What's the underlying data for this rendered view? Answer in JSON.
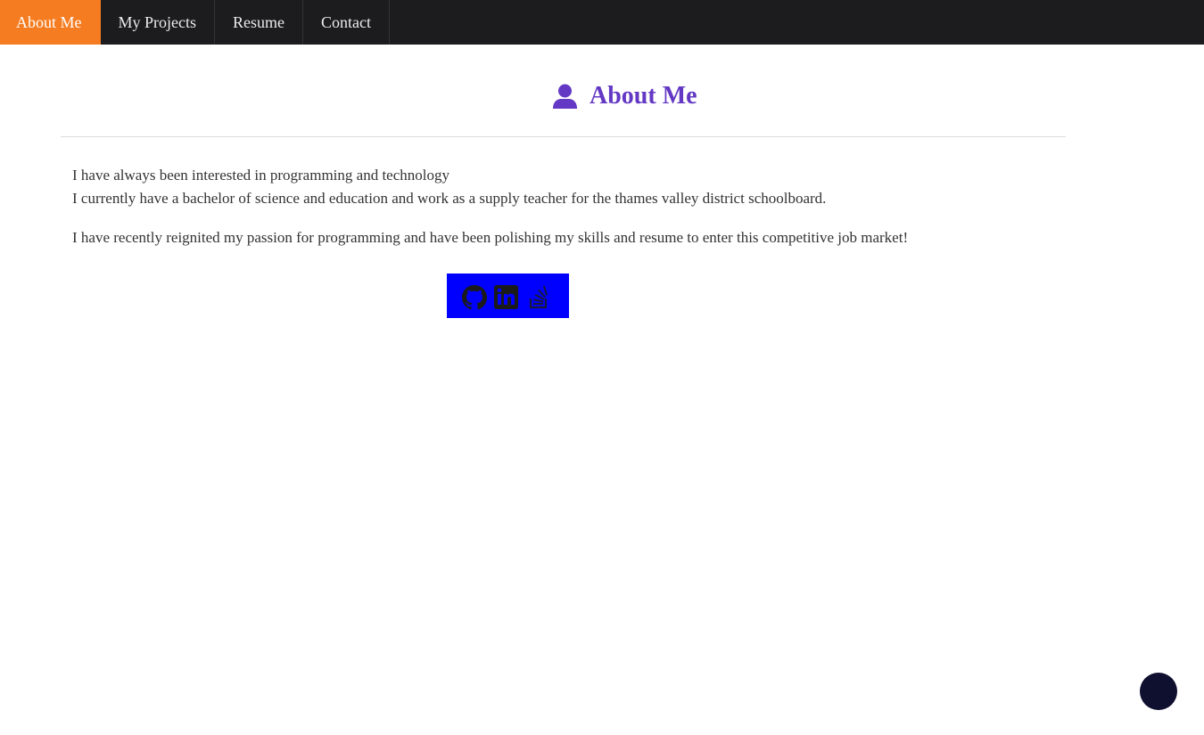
{
  "nav": {
    "items": [
      {
        "label": "About Me",
        "active": true
      },
      {
        "label": "My Projects",
        "active": false
      },
      {
        "label": "Resume",
        "active": false
      },
      {
        "label": "Contact",
        "active": false
      }
    ]
  },
  "header": {
    "title": "About Me",
    "icon": "user-icon",
    "title_color": "#6338c4"
  },
  "about": {
    "line1": "I have always been interested in programming and technology",
    "line2": "I currently have a bachelor of science and education and work as a supply teacher for the thames valley district schoolboard.",
    "line3": "I have recently reignited my passion for programming and have been polishing my skills and resume to enter this competitive job market!"
  },
  "social": {
    "background": "#0000ff",
    "links": [
      {
        "icon": "github-icon"
      },
      {
        "icon": "linkedin-icon"
      },
      {
        "icon": "stackoverflow-icon"
      }
    ]
  },
  "colors": {
    "nav_bg": "#1c1c1e",
    "nav_active": "#f57c20",
    "scroll_button": "#0f0f2f"
  }
}
